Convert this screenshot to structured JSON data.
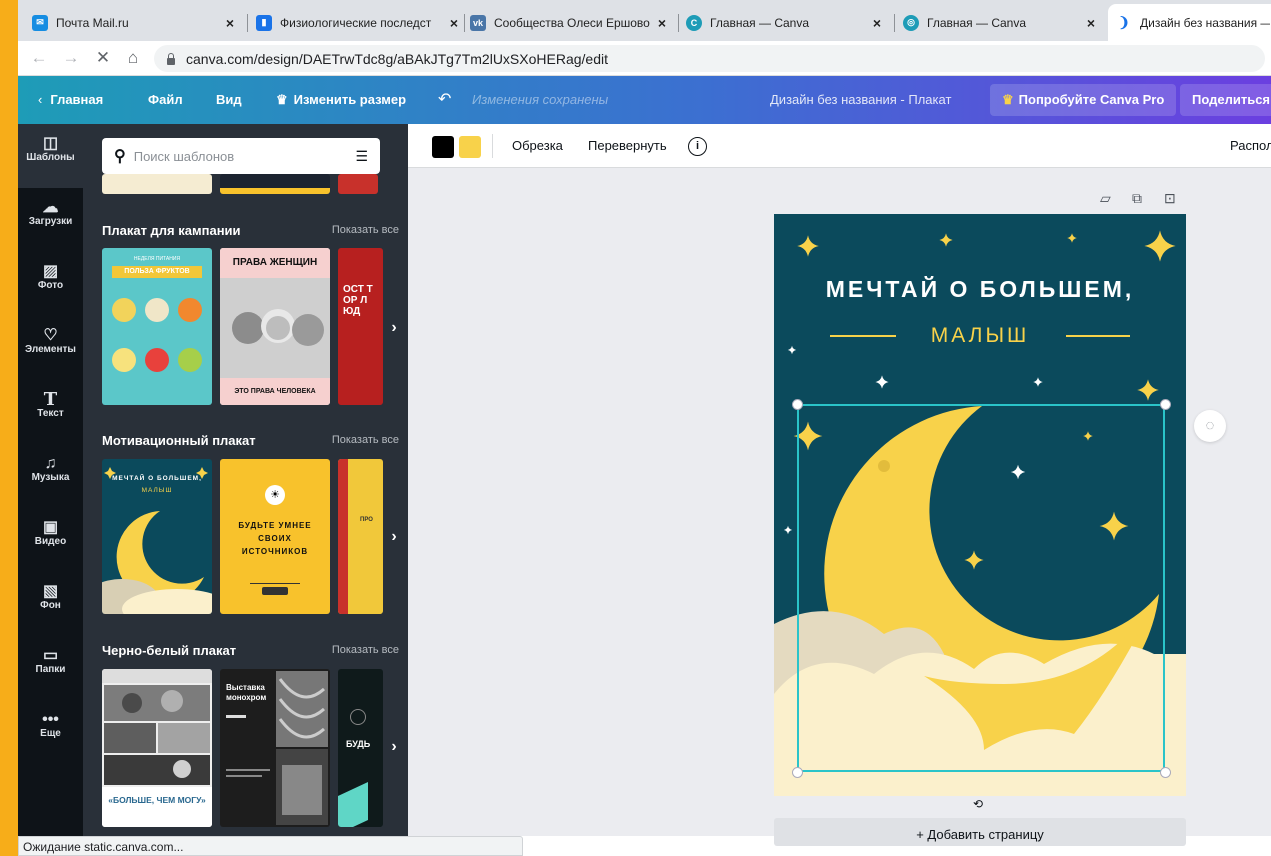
{
  "browser": {
    "tabs": [
      {
        "title": "Почта Mail.ru",
        "icon": "mail-icon",
        "color": "#168de2"
      },
      {
        "title": "Физиологические последст",
        "icon": "doc-icon",
        "color": "#1a73e8"
      },
      {
        "title": "Сообщества Олеси Ершово",
        "icon": "vk-icon",
        "color": "#4a76a8"
      },
      {
        "title": "Главная — Canva",
        "icon": "canva-icon",
        "color": "#1e9cb7"
      },
      {
        "title": "Главная — Canva",
        "icon": "canva-icon",
        "color": "#1e9cb7"
      },
      {
        "title": "Дизайн без названия —",
        "icon": "loading-icon",
        "color": "#1a73e8"
      }
    ],
    "url": "canva.com/design/DAETrwTdc8g/aBAkJTg7Tm2lUxSXoHERag/edit",
    "status": "Ожидание static.canva.com..."
  },
  "topbar": {
    "home": "Главная",
    "file": "Файл",
    "view": "Вид",
    "resize": "Изменить размер",
    "saved": "Изменения сохранены",
    "design_title": "Дизайн без названия - Плакат",
    "try_pro": "Попробуйте Canva Pro",
    "share": "Поделиться"
  },
  "rail": {
    "items": [
      "Шаблоны",
      "Загрузки",
      "Фото",
      "Элементы",
      "Текст",
      "Музыка",
      "Видео",
      "Фон",
      "Папки",
      "Еще"
    ]
  },
  "panel": {
    "search_placeholder": "Поиск шаблонов",
    "show_all": "Показать все",
    "sections": [
      {
        "title": "Плакат для кампании",
        "thumbs": [
          {
            "kicker": "НЕДЕЛЯ ПИТАНИЯ",
            "title": "ПОЛЬЗА ФРУКТОВ"
          },
          {
            "title": "ПРАВА ЖЕНЩИН",
            "footer": "ЭТО ПРАВА ЧЕЛОВЕКА"
          },
          {
            "title": "ОСТ ТОР ЛЮД"
          }
        ]
      },
      {
        "title": "Мотивационный плакат",
        "thumbs": [
          {
            "title": "МЕЧТАЙ О БОЛЬШЕМ,",
            "sub": "МАЛЫШ"
          },
          {
            "title": "БУДЬТЕ УМНЕЕ СВОИХ ИСТОЧНИКОВ"
          },
          {
            "title": "ПРО"
          }
        ]
      },
      {
        "title": "Черно-белый плакат",
        "thumbs": [
          {
            "title": "«БОЛЬШЕ, ЧЕМ МОГУ»"
          },
          {
            "title": "Выставка монохром"
          },
          {
            "title": "БУДЬ"
          }
        ]
      }
    ]
  },
  "editor": {
    "colors": [
      "#000000",
      "#f8d24a"
    ],
    "crop": "Обрезка",
    "flip": "Перевернуть",
    "arrange": "Располо",
    "add_page": "+ Добавить страницу"
  },
  "poster": {
    "title": "МЕЧТАЙ О БОЛЬШЕМ,",
    "subtitle": "МАЛЫШ",
    "bg": "#0b4a5c",
    "accent": "#f8d24a"
  }
}
